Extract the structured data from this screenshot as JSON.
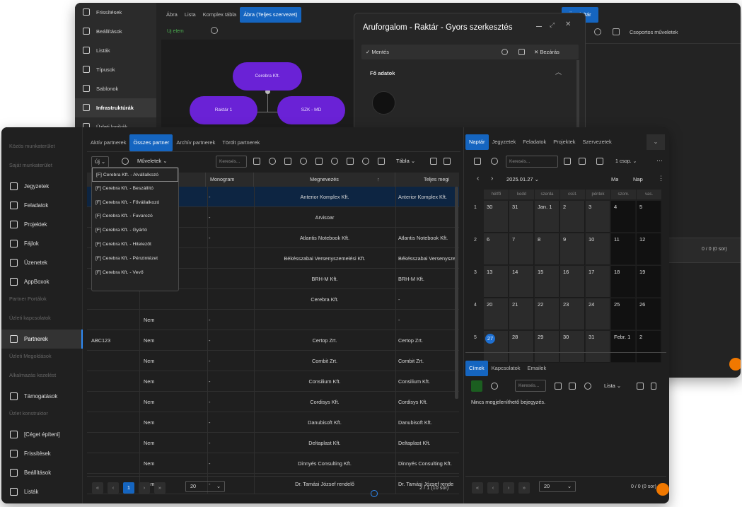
{
  "back": {
    "sidebar": [
      "Frissítések",
      "Beállítások",
      "Listák",
      "Típusok",
      "Sablonok",
      "Infrastruktúrák",
      "Üzleti logikák"
    ],
    "tabs": [
      "Ábra",
      "Lista",
      "Komplex tábla",
      "Ábra (Teljes szervezet)"
    ],
    "add_label": "Új elem",
    "nodes": {
      "top": "Cerebra Kft.",
      "left": "Raktár 1",
      "right": "SZK - MD"
    },
    "right_button": "Ügy leltár",
    "right_select": "Csoportos műveletek",
    "right_status": "0 / 0 (0 sor)"
  },
  "dialog": {
    "title": "Áruforgalom - Raktár - Gyors szerkesztés",
    "save": "Mentés",
    "cancel": "Bezárás",
    "section": "Fő adatok"
  },
  "sidebar": {
    "items": [
      {
        "label": "Közös munkaterület",
        "type": "section"
      },
      {
        "label": "Saját munkaterület",
        "type": "section"
      },
      {
        "label": "Jegyzetek",
        "type": "item",
        "icon": "note-icon"
      },
      {
        "label": "Feladatok",
        "type": "item",
        "icon": "check-circle-icon"
      },
      {
        "label": "Projektek",
        "type": "item",
        "icon": "briefcase-icon"
      },
      {
        "label": "Fájlok",
        "type": "item",
        "icon": "file-icon"
      },
      {
        "label": "Üzenetek",
        "type": "item",
        "icon": "message-icon"
      },
      {
        "label": "AppBoxok",
        "type": "item",
        "icon": "grid-icon"
      },
      {
        "label": "Partner Portálok",
        "type": "section"
      },
      {
        "label": "Üzleti kapcsolatok",
        "type": "section"
      },
      {
        "label": "Partnerek",
        "type": "item",
        "icon": "truck-icon",
        "active": true
      },
      {
        "label": "Üzleti Megoldások",
        "type": "section"
      },
      {
        "label": "Alkalmazás kezelést",
        "type": "section"
      },
      {
        "label": "Támogatások",
        "type": "item",
        "icon": "support-icon"
      },
      {
        "label": "Üzlet konstruktor",
        "type": "section"
      },
      {
        "label": "[Céget építeni]",
        "type": "item",
        "icon": "tools-icon"
      },
      {
        "label": "Frissítések",
        "type": "item",
        "icon": "refresh-icon"
      },
      {
        "label": "Beállítások",
        "type": "item",
        "icon": "users-icon"
      },
      {
        "label": "Listák",
        "type": "item",
        "icon": "list-icon"
      }
    ]
  },
  "tabs": [
    "Aktív partnerek",
    "Összes partner",
    "Archív partnerek",
    "Törölt partnerek"
  ],
  "toolbar": {
    "new": "Új",
    "ops": "Műveletek",
    "search": "Keresés...",
    "view": "Tábla"
  },
  "dropdown": [
    "[F] Cerebra Kft. - Alvállalkozó",
    "[F] Cerebra Kft. - Beszállító",
    "[F] Cerebra Kft. - Fővállalkozó",
    "[F] Cerebra Kft. - Fuvarozó",
    "[F] Cerebra Kft. - Gyártó",
    "[F] Cerebra Kft. - Hitelezőt",
    "[F] Cerebra Kft. - Pénzintézet",
    "[F] Cerebra Kft. - Vevő"
  ],
  "table": {
    "headers": [
      "ly",
      "Monogram",
      "Megnevezés",
      "Teljes megi"
    ],
    "rows": [
      [
        "",
        "",
        "-",
        "Anterior Komplex Kft.",
        "Anterior Komplex Kft."
      ],
      [
        "",
        "",
        "-",
        "Arvisoar",
        ""
      ],
      [
        "",
        "",
        "-",
        "Atlantis Notebook Kft.",
        "Atlantis Notebook Kft."
      ],
      [
        "",
        "",
        "",
        "Békésszabai Versenyszemelési Kft.",
        "Békésszabai Versenyszer"
      ],
      [
        "",
        "",
        "",
        "BRH-M Kft.",
        "BRH-M Kft."
      ],
      [
        "",
        "",
        "",
        "Cerebra Kft.",
        "-"
      ],
      [
        "",
        "Nem",
        "-",
        "",
        "-"
      ],
      [
        "ABC123",
        "Nem",
        "-",
        "Certop Zrt.",
        "Certop Zrt."
      ],
      [
        "",
        "Nem",
        "-",
        "Combit Zrt.",
        "Combit Zrt."
      ],
      [
        "",
        "Nem",
        "-",
        "Consilium Kft.",
        "Consilium Kft."
      ],
      [
        "",
        "Nem",
        "-",
        "Cordisys Kft.",
        "Cordisys Kft."
      ],
      [
        "",
        "Nem",
        "-",
        "Danubisoft Kft.",
        "Danubisoft Kft."
      ],
      [
        "",
        "Nem",
        "-",
        "Deltaplast Kft.",
        "Deltaplast Kft."
      ],
      [
        "",
        "Nem",
        "-",
        "Dinnyés Consulting Kft.",
        "Dinnyés Consulting Kft."
      ],
      [
        "",
        "Nem",
        "-",
        "Dr. Tamási József rendelő",
        "Dr. Tamási József rende"
      ]
    ]
  },
  "pager": {
    "page": "1",
    "size": "20",
    "status": "2 / 1 (10 sor)"
  },
  "right_tabs": [
    "Naptár",
    "Jegyzetek",
    "Feladatok",
    "Projektek",
    "Szervezetek"
  ],
  "cal_toolbar": {
    "search": "Keresés...",
    "mode": "1 csop."
  },
  "calendar": {
    "date": "2025.01.27",
    "views": [
      "Ma",
      "Nap"
    ],
    "weekdays": [
      "hétfő",
      "kedd",
      "szerda",
      "csüt.",
      "péntek",
      "szom.",
      "vas."
    ],
    "weeks": [
      {
        "no": "1",
        "days": [
          "30",
          "31",
          "Jan. 1",
          "2",
          "3",
          "4",
          "5"
        ]
      },
      {
        "no": "2",
        "days": [
          "6",
          "7",
          "8",
          "9",
          "10",
          "11",
          "12"
        ]
      },
      {
        "no": "3",
        "days": [
          "13",
          "14",
          "15",
          "16",
          "17",
          "18",
          "19"
        ]
      },
      {
        "no": "4",
        "days": [
          "20",
          "21",
          "22",
          "23",
          "24",
          "25",
          "26"
        ]
      },
      {
        "no": "5",
        "days": [
          "27",
          "28",
          "29",
          "30",
          "31",
          "Febr. 1",
          "2"
        ]
      }
    ]
  },
  "bottom_tabs": [
    "Címek",
    "Kapcsolatok",
    "Emailek"
  ],
  "bottom_toolbar": {
    "search": "Keresés...",
    "view": "Lista"
  },
  "bottom_empty": "Nincs megjeleníthető bejegyzés.",
  "bottom_pager": {
    "size": "20",
    "status": "0 / 0 (0 sor)"
  }
}
